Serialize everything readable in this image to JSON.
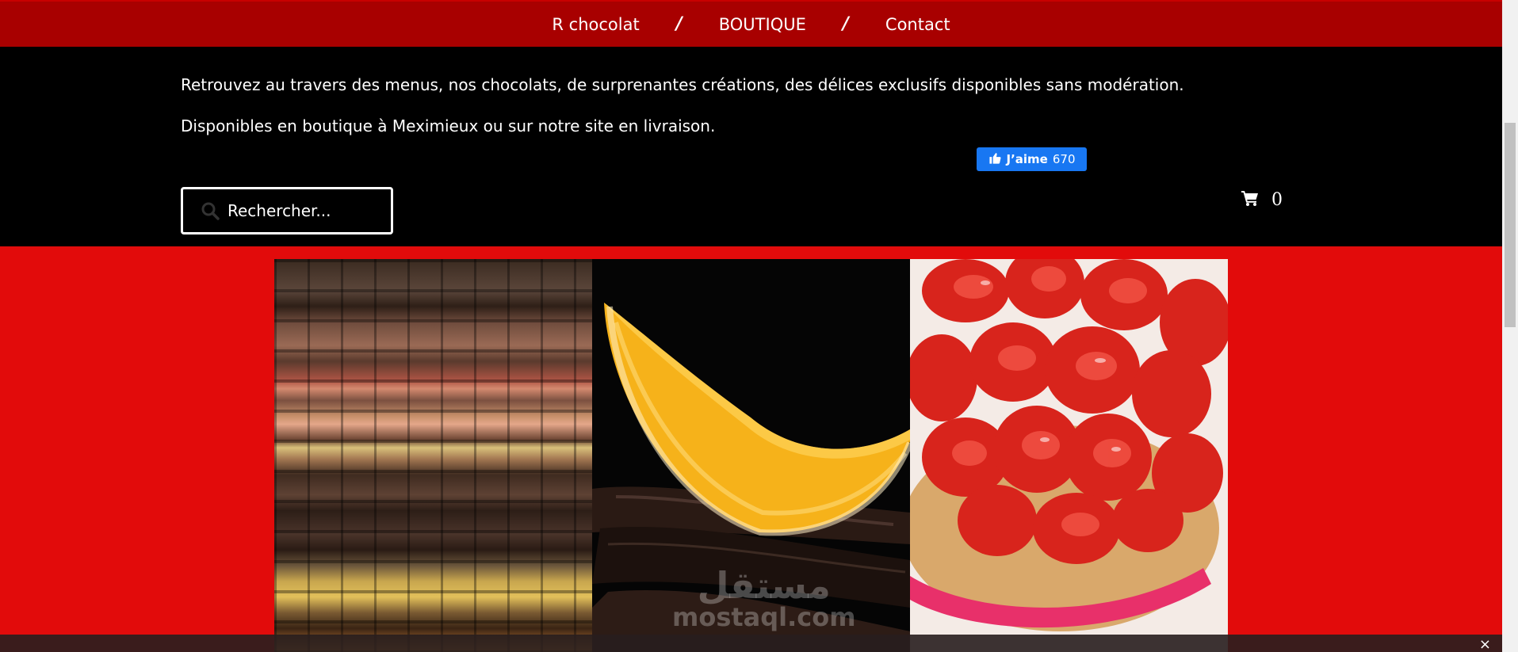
{
  "nav": {
    "items": [
      {
        "label": "R chocolat"
      },
      {
        "label": "BOUTIQUE"
      },
      {
        "label": "Contact"
      }
    ],
    "separator": "/"
  },
  "header": {
    "intro": "Retrouvez au travers des menus, nos chocolats, de surprenantes créations, des délices exclusifs disponibles sans modération. Disponibles en boutique à Meximieux ou sur notre site en livraison.",
    "fb_like_label": "J’aime",
    "fb_like_count": "670",
    "search_placeholder": "Rechercher...",
    "cart_count": "0"
  },
  "gallery": {
    "tiles": [
      {
        "icon": "chocolates-image"
      },
      {
        "icon": "orange-chocolate-image"
      },
      {
        "icon": "strawberry-tart-image"
      }
    ]
  },
  "watermark": {
    "arabic": "مستقل",
    "latin": "mostaql.com"
  },
  "bottom_bar": {
    "close_label": "×"
  },
  "colors": {
    "nav_bg": "#a80000",
    "header_bg": "#000000",
    "content_bg": "#e20b0b",
    "fb_blue": "#1877f2"
  }
}
